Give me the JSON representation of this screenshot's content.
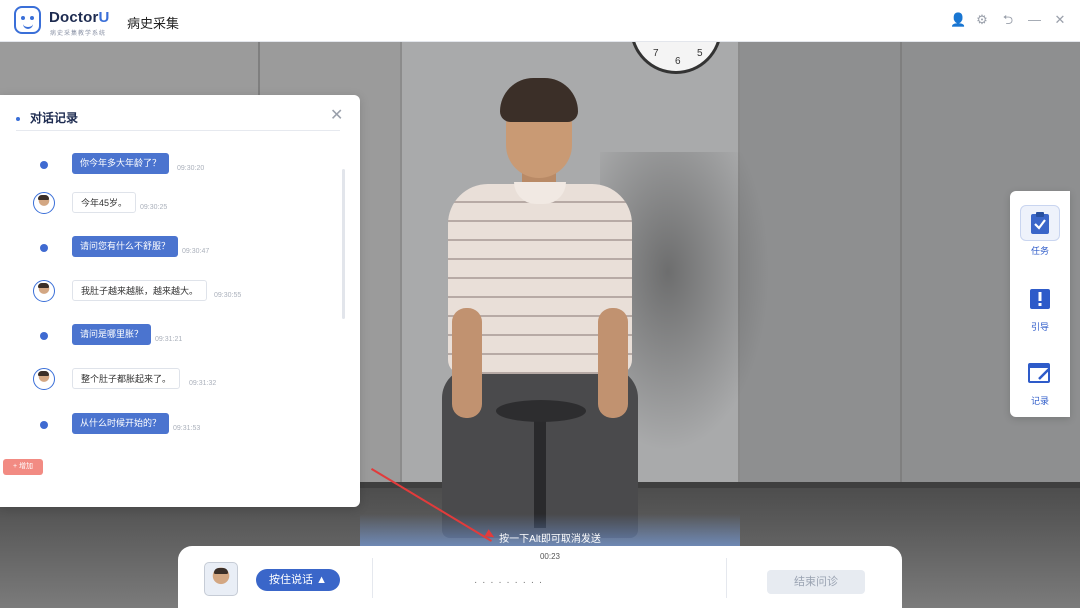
{
  "app": {
    "logo_main": "Doctor",
    "logo_accent": "U",
    "logo_sub": "病史采集教学系统",
    "title": "病史采集"
  },
  "window_controls": [
    {
      "name": "user-icon",
      "glyph": "👤"
    },
    {
      "name": "gear-icon",
      "glyph": "⚙"
    },
    {
      "name": "back-icon",
      "glyph": "⮌"
    },
    {
      "name": "minimize-icon",
      "glyph": "—"
    },
    {
      "name": "close-icon",
      "glyph": "✕"
    }
  ],
  "clock": {
    "numbers": [
      "7",
      "6",
      "5"
    ]
  },
  "chat": {
    "title": "对话记录",
    "close_glyph": "✕",
    "messages": [
      {
        "role": "doctor",
        "text": "你今年多大年龄了？",
        "time": "09:30:20"
      },
      {
        "role": "patient",
        "text": "今年45岁。",
        "time": "09:30:25"
      },
      {
        "role": "doctor",
        "text": "请问您有什么不舒服？",
        "time": "09:30:47"
      },
      {
        "role": "patient",
        "text": "我肚子越来越胀，越来越大。",
        "time": "09:30:55"
      },
      {
        "role": "doctor",
        "text": "请问是哪里胀？",
        "time": "09:31:21"
      },
      {
        "role": "patient",
        "text": "整个肚子都胀起来了。",
        "time": "09:31:32"
      },
      {
        "role": "doctor",
        "text": "从什么时候开始的？",
        "time": "09:31:53"
      }
    ],
    "side_button": "+ 增加"
  },
  "tools": [
    {
      "label": "任务",
      "icon": "clipboard-check-icon",
      "active": true
    },
    {
      "label": "引导",
      "icon": "alert-icon",
      "active": false
    },
    {
      "label": "记录",
      "icon": "edit-note-icon",
      "active": false
    }
  ],
  "hint": "按一下Alt即可取消发送",
  "timer": "00:23",
  "bottom": {
    "hold_button": "按住说话 ▲",
    "wave_text": "·  ·  ·  ·  ·  ·  ·  ·  ·",
    "end_button": "结束问诊"
  },
  "colors": {
    "accent": "#3a66c9",
    "danger": "#e23b3b"
  }
}
